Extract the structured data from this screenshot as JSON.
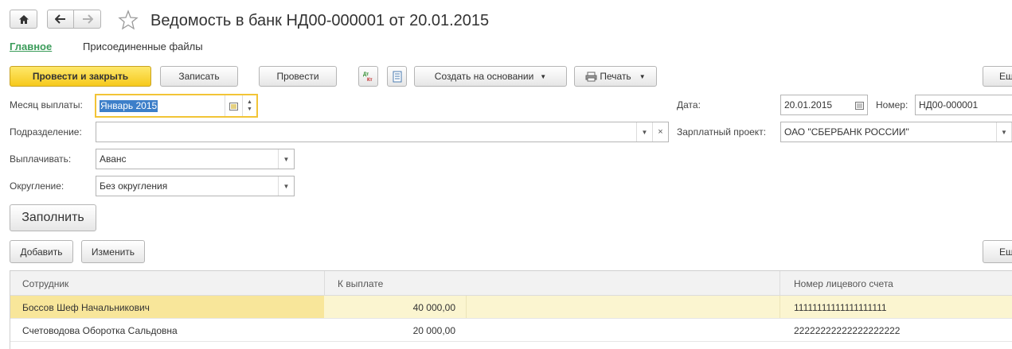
{
  "window": {
    "title": "Ведомость в банк НД00-000001 от 20.01.2015"
  },
  "nav": {
    "home_icon": "home-icon",
    "back_icon": "arrow-left-icon",
    "forward_icon": "arrow-right-icon",
    "favorite_icon": "star-icon"
  },
  "tabs": [
    {
      "label": "Главное"
    },
    {
      "label": "Присоединенные файлы"
    }
  ],
  "toolbar": {
    "post_close_label": "Провести и закрыть",
    "save_label": "Записать",
    "post_label": "Провести",
    "create_basis_label": "Создать на основании",
    "print_label": "Печать",
    "more_label": "Еш"
  },
  "form": {
    "pay_month": {
      "label": "Месяц выплаты:",
      "value": "Январь 2015"
    },
    "date": {
      "label": "Дата:",
      "value": "20.01.2015"
    },
    "number": {
      "label": "Номер:",
      "value": "НД00-000001"
    },
    "department": {
      "label": "Подразделение:",
      "value": ""
    },
    "salary_project": {
      "label": "Зарплатный проект:",
      "value": "ОАО \"СБЕРБАНК РОССИИ\""
    },
    "pay_type": {
      "label": "Выплачивать:",
      "value": "Аванс"
    },
    "rounding": {
      "label": "Округление:",
      "value": "Без округления"
    }
  },
  "fill_label": "Заполнить",
  "table_toolbar": {
    "add_label": "Добавить",
    "edit_label": "Изменить",
    "more_label": "Ещ"
  },
  "table": {
    "columns": [
      "Сотрудник",
      "К выплате",
      "Номер лицевого счета"
    ],
    "rows": [
      {
        "employee": "Боссов Шеф Начальникович",
        "amount": "40 000,00",
        "account": "11111111111111111111"
      },
      {
        "employee": "Счетоводова Оборотка Сальдовна",
        "amount": "20 000,00",
        "account": "22222222222222222222"
      }
    ]
  }
}
